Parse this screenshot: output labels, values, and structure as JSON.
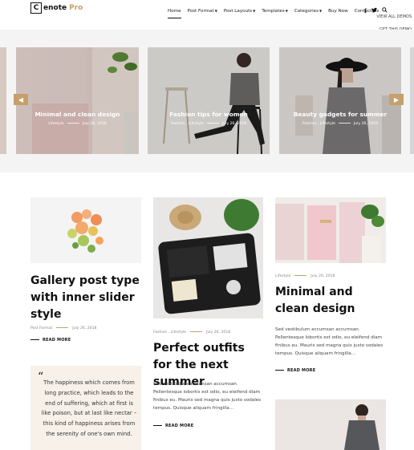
{
  "brand": {
    "box_letter": "C",
    "name": "enote",
    "pro": "Pro"
  },
  "nav": [
    {
      "label": "Home",
      "caret": false,
      "active": true
    },
    {
      "label": "Post Format",
      "caret": true
    },
    {
      "label": "Post Layouts",
      "caret": true
    },
    {
      "label": "Templates",
      "caret": true
    },
    {
      "label": "Categories",
      "caret": true
    },
    {
      "label": "Buy Now",
      "caret": false
    },
    {
      "label": "Contact Us",
      "caret": false
    }
  ],
  "side_links": {
    "view_all": "VIEW ALL DEMOS",
    "get": "GET THIS DEMO"
  },
  "slider": {
    "slides": [
      {
        "title": "Minimal and clean design",
        "category": "Lifestyle",
        "date": "July 26, 2018"
      },
      {
        "title": "Fashion tips for women",
        "category": "Fashion , Lifestyle",
        "date": "July 26, 2018"
      },
      {
        "title": "Beauty gadgets for summer",
        "category": "Fashion , Lifestyle",
        "date": "July 26, 2018"
      }
    ]
  },
  "posts": {
    "left": {
      "title": "Gallery post type with inner slider style",
      "category": "Post Format",
      "date": "July 26, 2018",
      "read_more": "READ MORE"
    },
    "quote": "The happiness which comes from long practice, which leads to the end of suffering, which at first is like poison, but at last like nectar – this kind of happiness arises from the serenity of one's own mind.",
    "middle": {
      "category": "Fashion , Lifestyle",
      "date": "July 26, 2018",
      "title": "Perfect outfits for the next summer",
      "excerpt": "Sed vestibulum accumsan accumsan. Pellentesque lobortis est odio, eu eleifend diam finibus eu. Mauris sed magna quis justo sodales tempus. Quisque aliquam fringilla...",
      "read_more": "READ MORE"
    },
    "right": {
      "category": "Lifestyle",
      "date": "July 26, 2018",
      "title": "Minimal and clean design",
      "excerpt": "Sed vestibulum accumsan accumsan. Pellentesque lobortis est odio, eu eleifend diam finibus eu. Mauris sed magna quis justo sodales tempus. Quisque aliquam fringilla...",
      "read_more": "READ MORE"
    }
  },
  "colors": {
    "accent": "#c5a06a"
  },
  "icons": [
    "facebook-icon",
    "twitter-icon",
    "search-icon",
    "arrow-left-icon",
    "arrow-right-icon",
    "quote-icon"
  ]
}
